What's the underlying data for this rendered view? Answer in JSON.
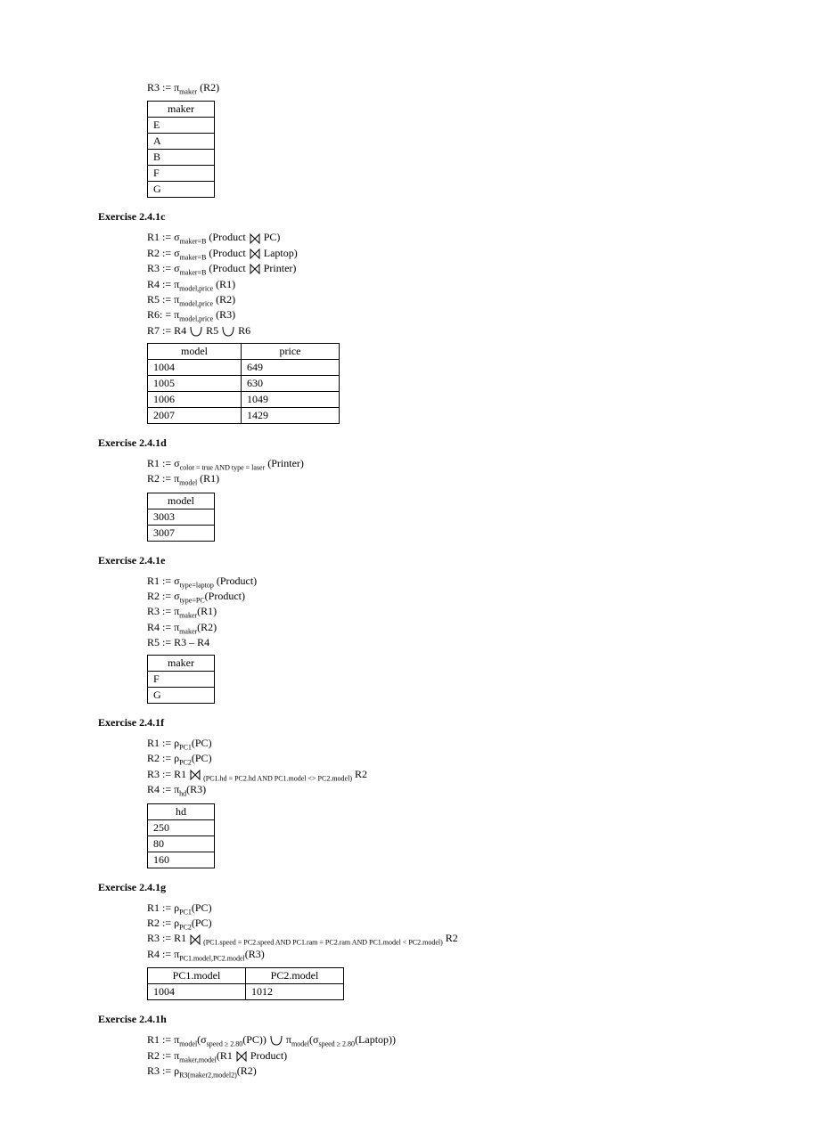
{
  "sec0": {
    "r3": "R3 := π",
    "r3_sub": "maker",
    "r3_end": " (R2)",
    "table_header": "maker",
    "table_rows": [
      "E",
      "A",
      "B",
      "F",
      "G"
    ]
  },
  "sec_c": {
    "heading": "Exercise 2.4.1c",
    "r1a": "R1 := σ",
    "r1sub": "maker=B",
    "r1b": " (Product ",
    "r1c": " PC)",
    "r2a": "R2 := σ",
    "r2sub": "maker=B",
    "r2b": " (Product ",
    "r2c": " Laptop)",
    "r3a": "R3 := σ",
    "r3sub": "maker=B",
    "r3b": " (Product ",
    "r3c": " Printer)",
    "r4a": "R4 := π",
    "r4sub": "model,price",
    "r4b": " (R1)",
    "r5a": "R5 := π",
    "r5sub": "model,price",
    "r5b": " (R2)",
    "r6a": "R6: = π",
    "r6sub": "model,price",
    "r6b": " (R3)",
    "r7a": "R7 := R4 ",
    "r7b": " R5 ",
    "r7c": " R6",
    "th1": "model",
    "th2": "price",
    "rows": [
      [
        "1004",
        "649"
      ],
      [
        "1005",
        "630"
      ],
      [
        "1006",
        "1049"
      ],
      [
        "2007",
        "1429"
      ]
    ]
  },
  "sec_d": {
    "heading": "Exercise 2.4.1d",
    "r1a": "R1 := σ",
    "r1sub": "color = true AND type = laser",
    "r1b": " (Printer)",
    "r2a": "R2 := π",
    "r2sub": "model",
    "r2b": " (R1)",
    "th": "model",
    "rows": [
      "3003",
      "3007"
    ]
  },
  "sec_e": {
    "heading": "Exercise 2.4.1e",
    "r1a": "R1 := σ",
    "r1sub": "type=laptop",
    "r1b": " (Product)",
    "r2a": "R2 := σ",
    "r2sub": "type=PC",
    "r2b": "(Product)",
    "r3a": "R3 := π",
    "r3sub": "maker",
    "r3b": "(R1)",
    "r4a": "R4 := π",
    "r4sub": "maker",
    "r4b": "(R2)",
    "r5": "R5 := R3 – R4",
    "th": "maker",
    "rows": [
      "F",
      "G"
    ]
  },
  "sec_f": {
    "heading": "Exercise 2.4.1f",
    "r1a": "R1 := ρ",
    "r1sub": "PC1",
    "r1b": "(PC)",
    "r2a": "R2 := ρ",
    "r2sub": "PC2",
    "r2b": "(PC)",
    "r3a": "R3 := R1 ",
    "r3sub": " (PC1.hd = PC2.hd AND PC1.model <> PC2.model)",
    "r3b": " R2",
    "r4a": "R4 := π",
    "r4sub": "hd",
    "r4b": "(R3)",
    "th": "hd",
    "rows": [
      "250",
      "80",
      "160"
    ]
  },
  "sec_g": {
    "heading": "Exercise 2.4.1g",
    "r1a": "R1 := ρ",
    "r1sub": "PC1",
    "r1b": "(PC)",
    "r2a": "R2 := ρ",
    "r2sub": "PC2",
    "r2b": "(PC)",
    "r3a": "R3 := R1 ",
    "r3sub": " (PC1.speed = PC2.speed AND PC1.ram = PC2.ram AND PC1.model < PC2.model)",
    "r3b": " R2",
    "r4a": "R4 := π",
    "r4sub": "PC1.model,PC2.model",
    "r4b": "(R3)",
    "th1": "PC1.model",
    "th2": "PC2.model",
    "rows": [
      [
        "1004",
        "1012"
      ]
    ]
  },
  "sec_h": {
    "heading": "Exercise 2.4.1h",
    "r1a": "R1 := π",
    "r1sub1": "model",
    "r1b": "(σ",
    "r1sub2": "speed ≥ 2.80",
    "r1c": "(PC)) ",
    "r1d": " π",
    "r1sub3": "model",
    "r1e": "(σ",
    "r1sub4": "speed ≥ 2.80",
    "r1f": "(Laptop))",
    "r2a": "R2 := π",
    "r2sub": "maker,model",
    "r2b": "(R1 ",
    "r2c": " Product)",
    "r3a": "R3 := ρ",
    "r3sub": "R3(maker2,model2)",
    "r3b": "(R2)"
  }
}
